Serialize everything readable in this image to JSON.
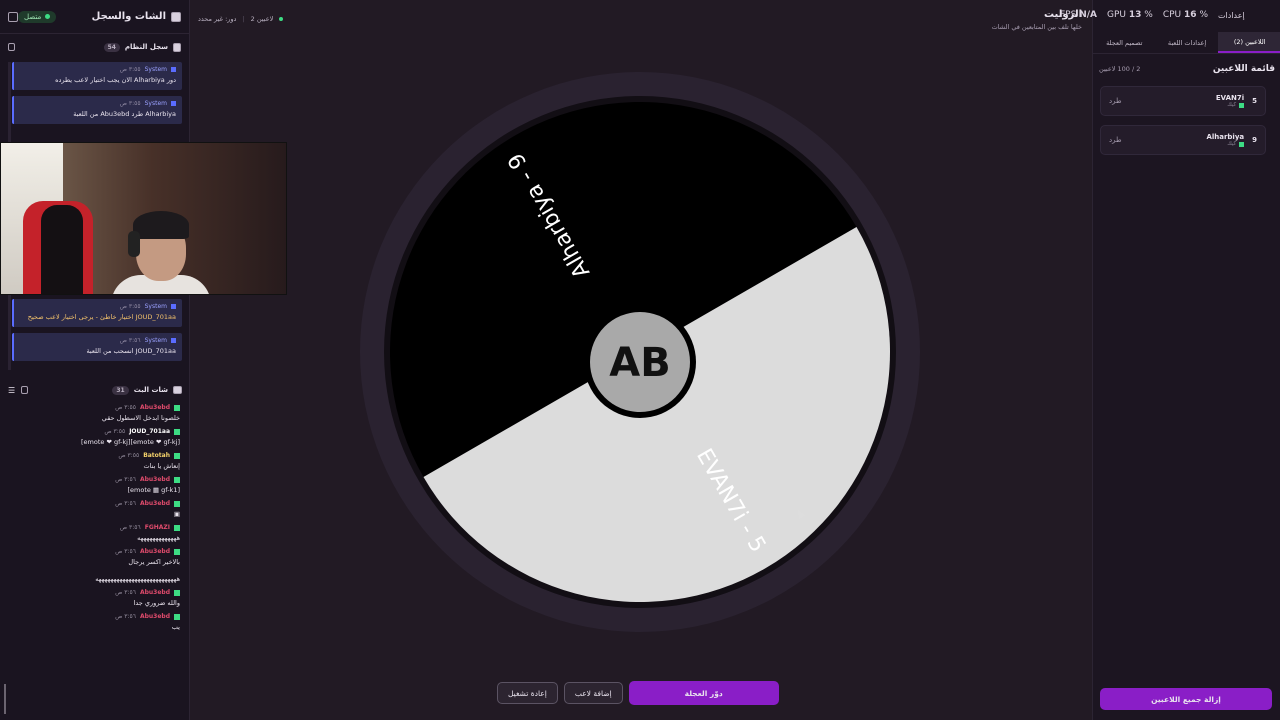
{
  "left_panel": {
    "title": "الشات والسجل",
    "status": "متصل",
    "system_log": {
      "title": "سجل النظام",
      "count": "54",
      "entries": [
        {
          "sender": "System",
          "time": "٣:٥٥ ص",
          "text": "دور Alharbiya الان يجب اختيار لاعب يطرده",
          "type": "normal"
        },
        {
          "sender": "System",
          "time": "٣:٥٥ ص",
          "text": "Alharbiya طرد Abu3ebd من اللعبة",
          "type": "normal"
        },
        {
          "sender": "System",
          "time": "٣:٥٥ ص",
          "text": "JOUD_701aa اختيار خاطئ - يرجى اختيار لاعب صحيح",
          "type": "warn"
        },
        {
          "sender": "System",
          "time": "٣:٥٦ ص",
          "text": "JOUD_701aa انسحب من اللعبة",
          "type": "normal"
        }
      ]
    },
    "live_chat": {
      "title": "شات البث",
      "count": "31",
      "messages": [
        {
          "user": "Abu3ebd",
          "time": "٣:٥٥ ص",
          "text": "خلصونا ابدخل الاسطول حقي",
          "color": "#e04b6c"
        },
        {
          "user": "JOUD_701aa",
          "time": "٣:٥٥ ص",
          "text": "[emote ❤ gf-kj][emote ❤ gf-kj]",
          "color": "#ffffff"
        },
        {
          "user": "Batotah",
          "time": "٣:٥٥ ص",
          "text": "إنعاش يا بنات",
          "color": "#f5d36b"
        },
        {
          "user": "Abu3ebd",
          "time": "٣:٥٦ ص",
          "text": "[emote ▦ gf-k1]",
          "color": "#e04b6c"
        },
        {
          "user": "Abu3ebd",
          "time": "٣:٥٦ ص",
          "text": "▣",
          "color": "#e04b6c"
        },
        {
          "user": "FGHAZI",
          "time": "٣:٥٦ ص",
          "text": "هههههههههههههه",
          "color": "#e04b6c"
        },
        {
          "user": "Abu3ebd",
          "time": "٣:٥٦ ص",
          "text": "بالاخير اكسر يرجال",
          "color": "#e04b6c"
        },
        {
          "user": "",
          "time": "",
          "text": "هههههههههههههههههههههههههههه",
          "color": "#e04b6c"
        },
        {
          "user": "Abu3ebd",
          "time": "٣:٥٦ ص",
          "text": "والله ضروري جدا",
          "color": "#e04b6c"
        },
        {
          "user": "Abu3ebd",
          "time": "٣:٥٦ ص",
          "text": "يب",
          "color": "#e04b6c"
        }
      ]
    }
  },
  "top_info": {
    "players": "2 لاعبين",
    "turn": "دور: غير محدد"
  },
  "game": {
    "title": "الروليت",
    "subtitle": "خلها تلف بين المتابعين في الشات",
    "center_logo": "AB",
    "segments": [
      {
        "label": "Alharbiya - 9",
        "color": "#000000",
        "text_color": "#ffffff"
      },
      {
        "label": "EVAN7i - 5",
        "color": "#dcdcdc",
        "text_color": "#ffffff"
      }
    ]
  },
  "controls": {
    "spin": "دوّر العجلة",
    "add_player": "إضافة لاعب",
    "restart": "إعادة تشغيل"
  },
  "stats": {
    "fps_label": "FPS",
    "fps_value": "N/A",
    "gpu_label": "GPU",
    "gpu_value": "13",
    "cpu_label": "CPU",
    "cpu_value": "16",
    "unit": "%",
    "settings": "إعدادات"
  },
  "right_panel": {
    "tabs": [
      "اللاعبين (2)",
      "إعدادات اللعبة",
      "تصميم العجلة"
    ],
    "list_title": "قائمة اللاعبين",
    "list_count": "2 / 100 لاعبين",
    "kick_label": "طرد",
    "player_sub": "كيك",
    "players": [
      {
        "name": "EVAN7i",
        "number": "5"
      },
      {
        "name": "Alharbiya",
        "number": "9"
      }
    ],
    "remove_all": "إزالة جميع اللاعبين"
  },
  "colors": {
    "accent": "#8a1ec7",
    "online": "#3ddc84",
    "system": "#5a6cff"
  }
}
